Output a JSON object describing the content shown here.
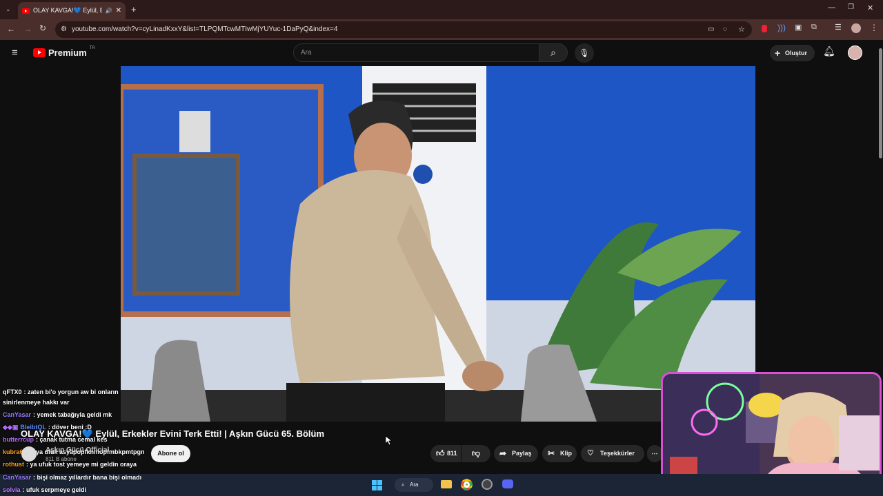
{
  "browser": {
    "tab_title": "OLAY KAVGA!💙 Eylül, Erke",
    "url": "youtube.com/watch?v=cyLinadKxxY&list=TLPQMTcwMTIwMjYUYuc-1DaPyQ&index=4"
  },
  "youtube": {
    "logo_text": "Premium",
    "logo_region": "TR",
    "search_placeholder": "Ara",
    "create_label": "Oluştur"
  },
  "chat": [
    {
      "user": "qFTX0",
      "text": ": zaten bi'o yorgun aw bi onların",
      "color": "#ffffff"
    },
    {
      "user": "",
      "text": "sinirlenmeye hakkı var",
      "color": "#ffffff"
    },
    {
      "user": "CanYasar",
      "text": ": yemek tabağıyla geldi mk",
      "color": "#9b7cff"
    },
    {
      "user": "BleibtQL",
      "text": ": döver beni :D",
      "color": "#5d8cff"
    },
    {
      "user": "butterrcup",
      "text": ": çanak tutma cemal kes",
      "color": "#b56bff"
    },
    {
      "user": "kubra654",
      "text": ": ya ufuk asyapopfknmopfmbkpmtpgn",
      "color": "#ff9f1a"
    },
    {
      "user": "rothust",
      "text": ": ya ufuk tost yemeye mi geldin oraya",
      "color": "#ff9f1a"
    },
    {
      "user": "CanYasar",
      "text": ": bişi olmaz yıllardır bana bişi olmadı",
      "color": "#9b7cff"
    },
    {
      "user": "solvia",
      "text": ": ufuk serpmeye geldi",
      "color": "#c07bff"
    }
  ],
  "video": {
    "title": "OLAY KAVGA!💙 Eylül, Erkekler Evini Terk Etti! | Aşkın Gücü 65. Bölüm",
    "channel": "Aşkın Gücü Official",
    "subscribers": "811 B abone",
    "subscribe_label": "Abone ol",
    "likes": "811",
    "share_label": "Paylaş",
    "clip_label": "Klip",
    "thanks_label": "Teşekkürler"
  },
  "taskbar": {
    "search_label": "Ara"
  },
  "colors": {
    "accent": "#ff0000",
    "cam_border": "#d94fd6",
    "browser_bg": "#4a2e2b"
  }
}
